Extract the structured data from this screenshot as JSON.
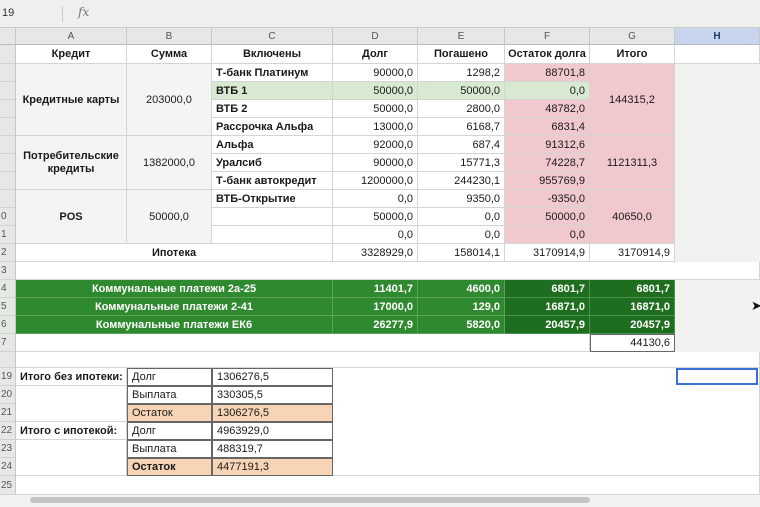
{
  "formula_bar": {
    "cell_ref": "19",
    "fx_label": "fx"
  },
  "columns": [
    "A",
    "B",
    "C",
    "D",
    "E",
    "F",
    "G",
    "H"
  ],
  "selected_column": "H",
  "row_numbers": [
    "",
    "",
    "",
    "",
    "",
    "",
    "",
    "",
    "",
    "0",
    "1",
    "2",
    "3",
    "4",
    "5",
    "6",
    "7",
    "",
    "19",
    "20",
    "21",
    "22",
    "23",
    "24",
    "25"
  ],
  "header": {
    "credit": "Кредит",
    "sum": "Сумма",
    "included": "Включены",
    "debt": "Долг",
    "paid": "Погашено",
    "remaining": "Остаток долга",
    "total": "Итого"
  },
  "groups": [
    {
      "name": "Кредитные карты",
      "sum": "203000,0",
      "total": "144315,2",
      "rows": [
        {
          "name": "Т-банк Платинум",
          "debt": "90000,0",
          "paid": "1298,2",
          "remaining": "88701,8"
        },
        {
          "name": "ВТБ 1",
          "debt": "50000,0",
          "paid": "50000,0",
          "remaining": "0,0"
        },
        {
          "name": "ВТБ 2",
          "debt": "50000,0",
          "paid": "2800,0",
          "remaining": "48782,0"
        },
        {
          "name": "Рассрочка Альфа",
          "debt": "13000,0",
          "paid": "6168,7",
          "remaining": "6831,4"
        }
      ]
    },
    {
      "name": "Потребительские кредиты",
      "sum": "1382000,0",
      "total": "1121311,3",
      "rows": [
        {
          "name": "Альфа",
          "debt": "92000,0",
          "paid": "687,4",
          "remaining": "91312,6"
        },
        {
          "name": "Уралсиб",
          "debt": "90000,0",
          "paid": "15771,3",
          "remaining": "74228,7"
        },
        {
          "name": "Т-банк автокредит",
          "debt": "1200000,0",
          "paid": "244230,1",
          "remaining": "955769,9"
        }
      ]
    },
    {
      "name": "POS",
      "sum": "50000,0",
      "total": "40650,0",
      "rows": [
        {
          "name": "ВТБ-Открытие",
          "debt": "0,0",
          "paid": "9350,0",
          "remaining": "-9350,0"
        },
        {
          "name": "",
          "debt": "50000,0",
          "paid": "0,0",
          "remaining": "50000,0"
        },
        {
          "name": "",
          "debt": "0,0",
          "paid": "0,0",
          "remaining": "0,0"
        }
      ]
    }
  ],
  "mortgage": {
    "label": "Ипотека",
    "debt": "3328929,0",
    "paid": "158014,1",
    "remaining": "3170914,9",
    "total": "3170914,9"
  },
  "utilities": [
    {
      "name": "Коммунальные платежи 2а-25",
      "debt": "11401,7",
      "paid": "4600,0",
      "remaining": "6801,7",
      "total": "6801,7"
    },
    {
      "name": "Коммунальные платежи 2-41",
      "debt": "17000,0",
      "paid": "129,0",
      "remaining": "16871,0",
      "total": "16871,0"
    },
    {
      "name": "Коммунальные платежи ЕК6",
      "debt": "26277,9",
      "paid": "5820,0",
      "remaining": "20457,9",
      "total": "20457,9"
    }
  ],
  "utilities_sum": "44130,6",
  "summary_without": {
    "label": "Итого без ипотеки:",
    "debt_label": "Долг",
    "debt": "1306276,5",
    "pay_label": "Выплата",
    "pay": "330305,5",
    "rest_label": "Остаток",
    "rest": "1306276,5"
  },
  "summary_with": {
    "label": "Итого с ипотекой:",
    "debt_label": "Долг",
    "debt": "4963929,0",
    "pay_label": "Выплата",
    "pay": "488319,7",
    "rest_label": "Остаток",
    "rest": "4477191,3"
  },
  "colors": {
    "pink": "#f1c8ce",
    "light_green": "#d7ead1",
    "green": "#2f8a2f",
    "dark_green": "#1f6e1f",
    "peach": "#f6d4b5",
    "selection": "#3d6fd6"
  }
}
